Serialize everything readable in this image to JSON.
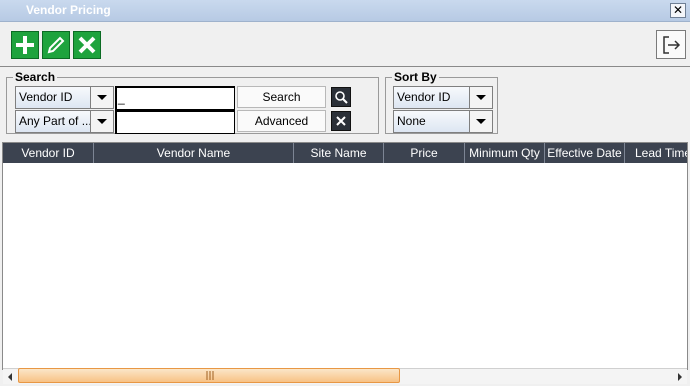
{
  "window": {
    "title": "Vendor Pricing",
    "close_glyph": "✕"
  },
  "toolbar": {
    "add_icon": "plus-icon",
    "edit_icon": "pencil-icon",
    "delete_icon": "x-icon",
    "exit_icon": "exit-icon",
    "accent": "#1ea33d"
  },
  "search": {
    "legend": "Search",
    "field1": {
      "selected": "Vendor ID"
    },
    "field2": {
      "selected": "Any Part of ..."
    },
    "text1_value": "_",
    "text2_value": "",
    "search_label": "Search",
    "advanced_label": "Advanced"
  },
  "sortby": {
    "legend": "Sort By",
    "primary": "Vendor ID",
    "secondary": "None"
  },
  "table": {
    "columns": [
      "Vendor ID",
      "Vendor Name",
      "Site Name",
      "Price",
      "Minimum Qty",
      "Effective Date",
      "Lead Time"
    ],
    "rows": [],
    "header_color": "#3c4350"
  },
  "scrollbar": {
    "thumb_color": "#f8c285"
  }
}
